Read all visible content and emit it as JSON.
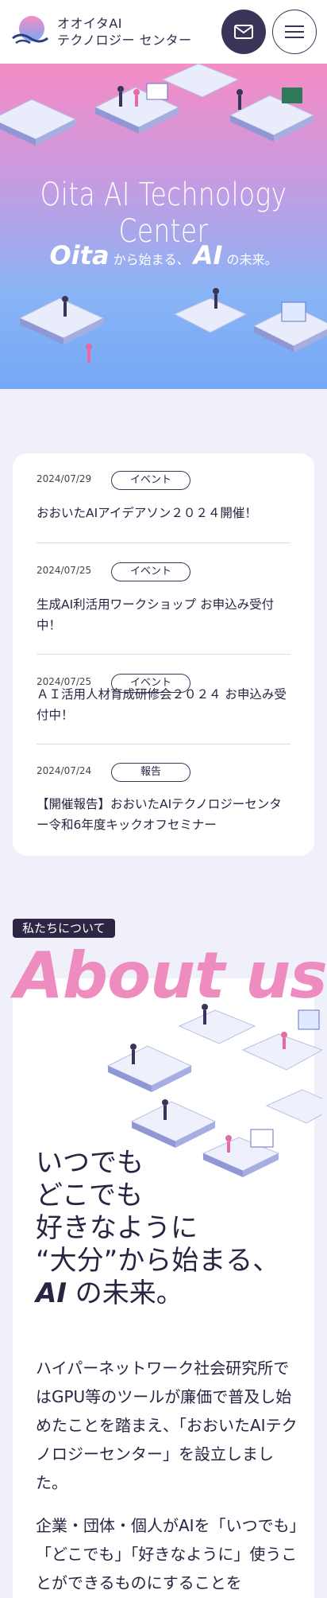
{
  "header": {
    "logo_line1": "オオイタAI",
    "logo_line2": "テクノロジー センター",
    "mail_icon": "envelope-icon",
    "menu_icon": "hamburger-icon"
  },
  "hero": {
    "title": "Oita AI Technology Center",
    "tag_oita": "Oita",
    "tag_mid": "から始まる、",
    "tag_ai": "AI",
    "tag_end": "の未来。"
  },
  "news": [
    {
      "date": "2024/07/29",
      "tag": "イベント",
      "title": "おおいたAIアイデアソン２０２４開催！"
    },
    {
      "date": "2024/07/25",
      "tag": "イベント",
      "title": "生成AI利活用ワークショップ お申込み受付中！"
    },
    {
      "date": "2024/07/25",
      "tag": "イベント",
      "title": "ＡＩ活用人材育成研修会２０２４ お申込み受付中！"
    },
    {
      "date": "2024/07/24",
      "tag": "報告",
      "title": "【開催報告】おおいたAIテクノロジーセンター令和6年度キックオフセミナー"
    }
  ],
  "about": {
    "badge": "私たちについて",
    "title_en": "About us",
    "head_l1": "いつでも",
    "head_l2": "どこでも",
    "head_l3": "好きなように",
    "head_l4": "“大分”から始まる、",
    "head_ai": "AI",
    "head_l5_rest": " の未来。",
    "para1": "ハイパーネットワーク社会研究所ではGPU等のツールが廉価で普及し始めたことを踏まえ、「おおいたAIテクノロジーセンター」を設立しました。",
    "para2": "企業・団体・個人がAIを「いつでも」「どこでも」「好きなように」使うことができるものにすることを"
  },
  "colors": {
    "pink": "#ee8bbf",
    "navy": "#3b3458",
    "bg": "#eff0fa"
  }
}
